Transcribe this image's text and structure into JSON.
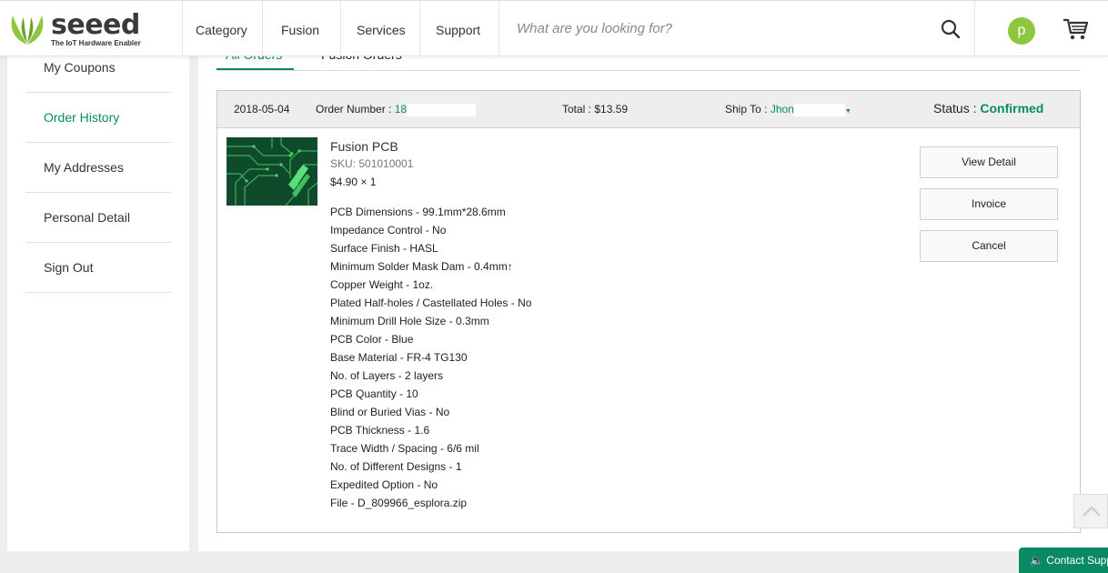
{
  "header": {
    "logo_word": "seeed",
    "logo_tagline": "The IoT Hardware Enabler",
    "nav": [
      "Category",
      "Fusion",
      "Services",
      "Support"
    ],
    "search_placeholder": "What are you looking for?",
    "avatar_letter": "p",
    "icons": [
      "search-icon",
      "cart-icon"
    ]
  },
  "sidebar": {
    "items": [
      {
        "label": "My Coupons",
        "active": false
      },
      {
        "label": "Order History",
        "active": true
      },
      {
        "label": "My Addresses",
        "active": false
      },
      {
        "label": "Personal Detail",
        "active": false
      },
      {
        "label": "Sign Out",
        "active": false
      }
    ]
  },
  "tabs": {
    "all_orders": "All Orders",
    "fusion_orders": "Fusion Orders"
  },
  "order": {
    "date": "2018-05-04",
    "order_number_label": "Order Number :",
    "order_number": "18",
    "total": "Total : $13.59",
    "ship_to_label": "Ship To :",
    "ship_to_name": "Jhon",
    "status_label": "Status :",
    "status": "Confirmed",
    "product": {
      "name": "Fusion PCB",
      "sku": "SKU: 501010001",
      "price": "$4.90 × 1",
      "specs": [
        "PCB Dimensions - 99.1mm*28.6mm",
        "Impedance Control - No",
        "Surface Finish - HASL",
        "Minimum Solder Mask Dam - 0.4mm↑",
        "Copper Weight - 1oz.",
        "Plated Half-holes / Castellated Holes - No",
        "Minimum Drill Hole Size - 0.3mm",
        "PCB Color - Blue",
        "Base Material - FR-4 TG130",
        "No. of Layers - 2 layers",
        "PCB Quantity - 10",
        "Blind or Buried Vias - No",
        "PCB Thickness - 1.6",
        "Trace Width / Spacing - 6/6 mil",
        "No. of Different Designs - 1",
        "Expedited Option - No",
        "File - D_809966_esplora.zip"
      ]
    },
    "actions": [
      "View Detail",
      "Invoice",
      "Cancel"
    ]
  },
  "contact": "Contact Support",
  "colors": {
    "accent": "#0a8a63",
    "avatar": "#8dc63f"
  }
}
